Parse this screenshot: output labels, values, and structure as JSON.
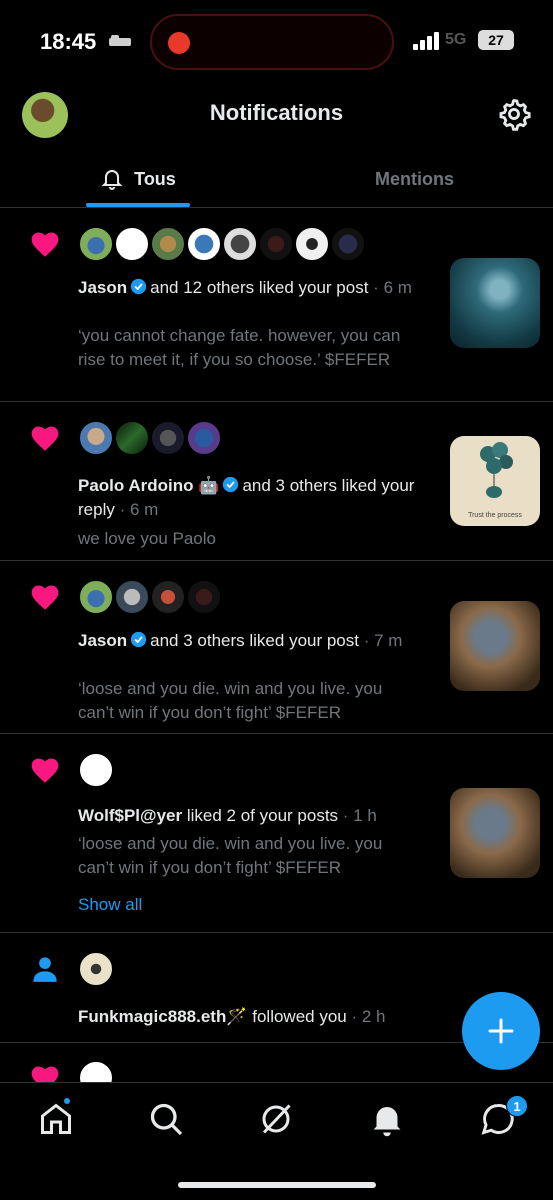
{
  "status_bar": {
    "time": "18:45",
    "carrier": "5G",
    "battery": "27"
  },
  "header": {
    "title": "Notifications"
  },
  "tabs": [
    {
      "label": "Tous",
      "active": true
    },
    {
      "label": "Mentions",
      "active": false
    }
  ],
  "colors": {
    "accent": "#1d9bf0",
    "like": "#f91880",
    "muted": "#71767b",
    "background": "#000000"
  },
  "notifications": [
    {
      "type": "like",
      "actor": "Jason",
      "verified": true,
      "action": "and 12 others liked your post",
      "time": "6 m",
      "text": "‘you cannot change fate. however, you can rise to meet it, if you so choose.’ $FEFER"
    },
    {
      "type": "like",
      "actor": "Paolo Ardoino",
      "actor_emoji": "🤖",
      "verified": true,
      "action": "and 3 others liked your reply",
      "time": "6 m",
      "text": "we love you Paolo"
    },
    {
      "type": "like",
      "actor": "Jason",
      "verified": true,
      "action": "and 3 others liked your post",
      "time": "7 m",
      "text": "‘loose and you die. win and you live. you can’t win if you don’t fight’ $FEFER"
    },
    {
      "type": "like",
      "actor": "Wolf$Pl@yer",
      "verified": false,
      "action": "liked 2 of your posts",
      "time": "1 h",
      "text": "‘loose and you die. win and you live. you can’t win if you don’t fight’ $FEFER",
      "show_all": "Show all"
    },
    {
      "type": "follow",
      "actor": "Funkmagic888.eth",
      "actor_emoji": "🪄",
      "action": "followed you",
      "time": "2 h"
    }
  ],
  "thumbnail_caption": "Trust the process",
  "bottom_nav": {
    "items": [
      "home-icon",
      "search-icon",
      "grok-icon",
      "notifications-icon",
      "messages-icon"
    ],
    "messages_badge": "1"
  }
}
